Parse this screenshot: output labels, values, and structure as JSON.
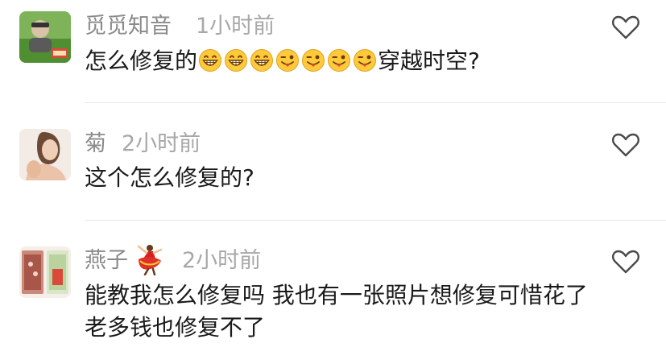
{
  "comments": [
    {
      "username": "觅觅知音",
      "time": "1小时前",
      "text_before": "怎么修复的",
      "emojis": [
        "grin-emoji",
        "grin-emoji",
        "grin-emoji",
        "tongue-wink-emoji",
        "tongue-wink-emoji",
        "tongue-wink-emoji",
        "tongue-wink-emoji"
      ],
      "text_after": "穿越时空?",
      "avatar_icon": "user-avatar-landscape",
      "like_icon": "heart-outline-icon"
    },
    {
      "username": "菊",
      "time": "2小时前",
      "text": "这个怎么修复的?",
      "avatar_icon": "user-avatar-portrait",
      "like_icon": "heart-outline-icon"
    },
    {
      "username": "燕子",
      "time": "2小时前",
      "badge_icon": "dancer-emoji",
      "text_line1": "能教我怎么修复吗 我也有一张照片想修复可惜花了",
      "text_line2": "老多钱也修复不了",
      "avatar_icon": "user-avatar-photos",
      "like_icon": "heart-outline-icon"
    }
  ],
  "colors": {
    "username": "#8a8a8a",
    "time": "#a8a8a8",
    "text": "#1a1a1a",
    "divider": "#e8e8e8",
    "heart": "#4a4a4a"
  }
}
